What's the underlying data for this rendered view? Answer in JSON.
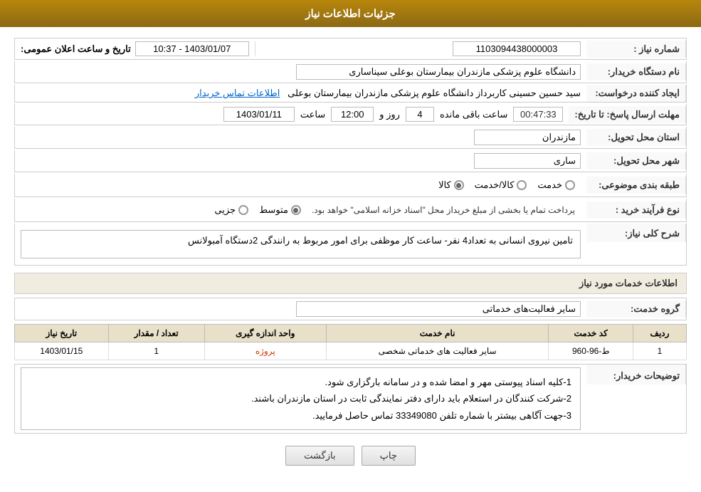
{
  "header": {
    "title": "جزئیات اطلاعات نیاز"
  },
  "fields": {
    "request_number_label": "شماره نیاز :",
    "request_number_value": "1103094438000003",
    "buyer_org_label": "نام دستگاه خریدار:",
    "buyer_org_value": "دانشگاه علوم پزشکی مازندران بیمارستان بوعلی سیناساری",
    "requester_label": "ایجاد کننده درخواست:",
    "requester_name": "سید حسین حسینی کاربرداز دانشگاه علوم پزشکی مازندران بیمارستان بوعلی",
    "requester_link": "اطلاعات تماس خریدار",
    "deadline_label": "مهلت ارسال پاسخ: تا تاریخ:",
    "deadline_date": "1403/01/11",
    "deadline_time_label": "ساعت",
    "deadline_time": "12:00",
    "deadline_days_label": "روز و",
    "deadline_days": "4",
    "countdown_label": "ساعت باقی مانده",
    "countdown_value": "00:47:33",
    "province_label": "استان محل تحویل:",
    "province_value": "مازندران",
    "city_label": "شهر محل تحویل:",
    "city_value": "ساری",
    "category_label": "طبقه بندی موضوعی:",
    "category_options": [
      "کالا",
      "خدمت",
      "کالا/خدمت"
    ],
    "category_selected": "کالا",
    "purchase_type_label": "نوع فرآیند خرید :",
    "purchase_options": [
      "جزیی",
      "متوسط"
    ],
    "purchase_note": "پرداخت تمام یا بخشی از مبلغ خریداز محل \"اسناد خزانه اسلامی\" خواهد بود.",
    "need_desc_label": "شرح کلی نیاز:",
    "need_desc_value": "تامین نیروی انسانی به تعداد4 نفر- ساعت کار موظفی برای امور مربوط به رانندگی 2دستگاه آمبولانس",
    "services_section": "اطلاعات خدمات مورد نیاز",
    "service_group_label": "گروه خدمت:",
    "service_group_value": "سایر فعالیت‌های خدماتی",
    "table": {
      "headers": [
        "ردیف",
        "کد خدمت",
        "نام خدمت",
        "واحد اندازه گیری",
        "تعداد / مقدار",
        "تاریخ نیاز"
      ],
      "rows": [
        {
          "row": "1",
          "code": "ط-96-960",
          "name": "سایر فعالیت های خدماتی شخصی",
          "unit": "پروژه",
          "quantity": "1",
          "date": "1403/01/15"
        }
      ]
    },
    "buyer_notes_label": "توضیحات خریدار:",
    "buyer_notes": [
      "1-کلیه اسناد پیوستی مهر و امضا شده و در سامانه بارگزاری شود.",
      "2-شرکت کنندگان در استعلام باید دارای دفتر نمایندگی ثابت در استان مازندران باشند.",
      "3-جهت آگاهی بیشتر با شماره تلفن 33349080 تماس حاصل فرمایید."
    ],
    "announce_label": "تاریخ و ساعت اعلان عمومی:",
    "announce_value": "1403/01/07 - 10:37"
  },
  "buttons": {
    "back_label": "بازگشت",
    "print_label": "چاپ"
  }
}
